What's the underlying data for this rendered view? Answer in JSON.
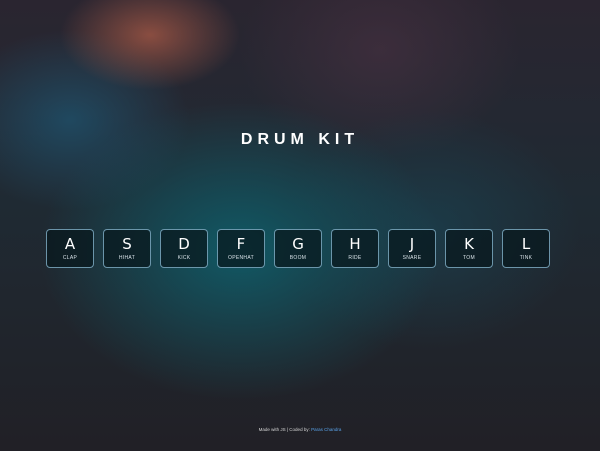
{
  "title": "DRUM KIT",
  "keys": [
    {
      "letter": "A",
      "sound": "CLAP"
    },
    {
      "letter": "S",
      "sound": "HIHAT"
    },
    {
      "letter": "D",
      "sound": "KICK"
    },
    {
      "letter": "F",
      "sound": "OPENHAT"
    },
    {
      "letter": "G",
      "sound": "BOOM"
    },
    {
      "letter": "H",
      "sound": "RIDE"
    },
    {
      "letter": "J",
      "sound": "SNARE"
    },
    {
      "letter": "K",
      "sound": "TOM"
    },
    {
      "letter": "L",
      "sound": "TINK"
    }
  ],
  "footer": {
    "text": "Made with JS | Coded by: ",
    "author_link": "Paras Chandra"
  },
  "colors": {
    "link": "#5aa3ea",
    "key_border": "#8cbed7"
  }
}
